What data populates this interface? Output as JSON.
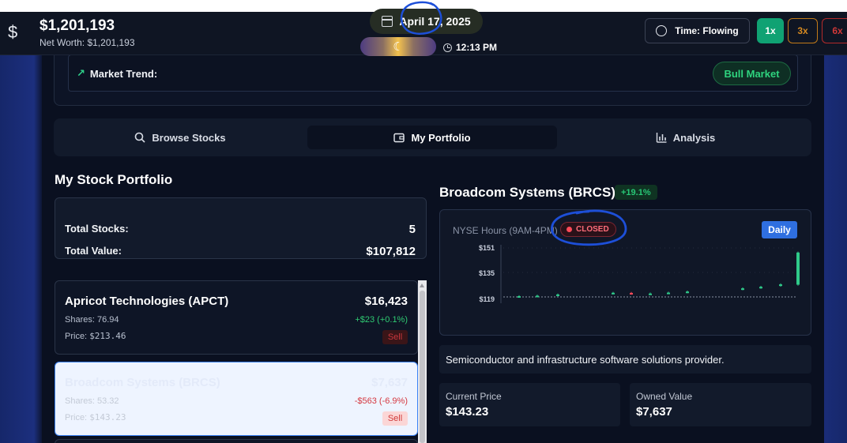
{
  "header": {
    "currency_symbol": "$",
    "net_worth_main": "$1,201,193",
    "net_worth_sub": "Net Worth: $1,201,193",
    "date": "April 17, 2025",
    "time": "12:13 PM",
    "time_mode": "Time: Flowing",
    "speeds": [
      "1x",
      "3x",
      "6x"
    ],
    "active_speed": "1x"
  },
  "market_trend": {
    "label": "Market Trend:",
    "value": "Bull Market"
  },
  "tabs": [
    {
      "label": "Browse Stocks",
      "icon": "search-icon"
    },
    {
      "label": "My Portfolio",
      "icon": "wallet-icon",
      "active": true
    },
    {
      "label": "Analysis",
      "icon": "bar-chart-icon"
    }
  ],
  "portfolio": {
    "title": "My Stock Portfolio",
    "total_stocks_label": "Total Stocks:",
    "total_stocks": "5",
    "total_value_label": "Total Value:",
    "total_value": "$107,812",
    "stocks": [
      {
        "name": "Apricot Technologies (APCT)",
        "value": "$16,423",
        "shares_label": "Shares:",
        "shares": "76.94",
        "price_label": "Price:",
        "price": "$213.46",
        "change": "+$23 (+0.1%)",
        "sell": "Sell"
      },
      {
        "name": "Broadcom Systems (BRCS)",
        "value": "$7,637",
        "shares_label": "Shares:",
        "shares": "53.32",
        "price_label": "Price:",
        "price": "$143.23",
        "change": "-$563 (-6.9%)",
        "sell": "Sell"
      }
    ]
  },
  "detail": {
    "title": "Broadcom Systems (BRCS)",
    "change_badge": "+19.1%",
    "hours_label": "NYSE Hours (9AM-4PM)",
    "status": "CLOSED",
    "period_button": "Daily",
    "description": "Semiconductor and infrastructure software solutions provider.",
    "current_price_label": "Current Price",
    "current_price": "$143.23",
    "owned_value_label": "Owned Value",
    "owned_value": "$7,637"
  },
  "colors": {
    "up": "#2fca72",
    "down": "#d5373f",
    "accent": "#2f6fe0",
    "annotation": "#1d4fd8"
  },
  "chart_data": {
    "type": "candlestick",
    "y_ticks": [
      "$151",
      "$135",
      "$119"
    ],
    "ylim": [
      113,
      155
    ],
    "reference_line": 119,
    "candles": [
      {
        "open": 119.3,
        "close": 119.5,
        "dir": "up"
      },
      {
        "open": 119.6,
        "close": 119.8,
        "dir": "up"
      },
      {
        "open": 120.1,
        "close": 120.6,
        "dir": "up"
      },
      {
        "open": 121.3,
        "close": 121.7,
        "dir": "up"
      },
      {
        "open": 121.6,
        "close": 121.1,
        "dir": "down"
      },
      {
        "open": 121.0,
        "close": 121.2,
        "dir": "up"
      },
      {
        "open": 121.4,
        "close": 121.8,
        "dir": "up"
      },
      {
        "open": 122.0,
        "close": 122.5,
        "dir": "up"
      },
      {
        "open": 124.0,
        "close": 124.6,
        "dir": "up"
      },
      {
        "open": 125.0,
        "close": 125.6,
        "dir": "up"
      },
      {
        "open": 126.3,
        "close": 127.2,
        "dir": "up"
      },
      {
        "open": 127.0,
        "close": 148.0,
        "dir": "up"
      }
    ]
  }
}
